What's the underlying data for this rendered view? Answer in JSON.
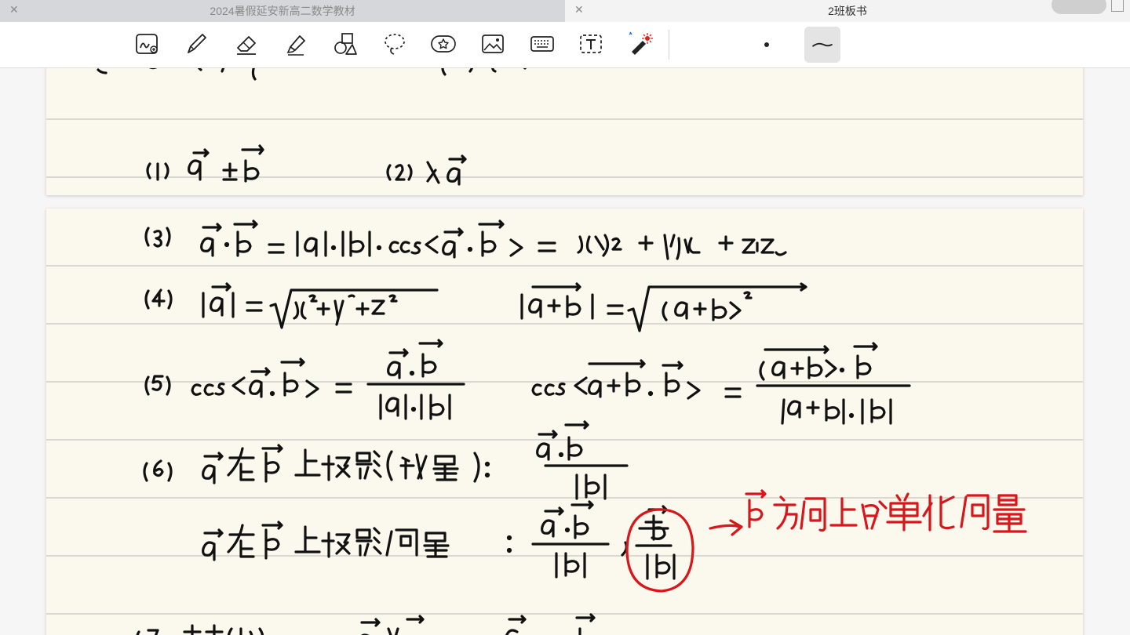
{
  "tabs": [
    {
      "title": "2024暑假延安新高二数学教材",
      "close_icon": "close-icon"
    },
    {
      "title": "2班板书",
      "close_icon": "close-icon"
    }
  ],
  "toolbar": {
    "tools": [
      {
        "name": "handwriting-to-text-icon"
      },
      {
        "name": "pen-icon"
      },
      {
        "name": "eraser-icon"
      },
      {
        "name": "highlighter-icon"
      },
      {
        "name": "shapes-icon"
      },
      {
        "name": "lasso-icon"
      },
      {
        "name": "sticker-icon"
      },
      {
        "name": "image-icon"
      },
      {
        "name": "keyboard-icon"
      },
      {
        "name": "text-box-icon"
      },
      {
        "name": "laser-pointer-icon"
      }
    ],
    "stroke_style": "curve-stroke-icon"
  },
  "colors": {
    "ink": "#111111",
    "red_ink": "#d8161b",
    "paper": "#fbf9ee",
    "rule_line": "#d9d9d2"
  }
}
